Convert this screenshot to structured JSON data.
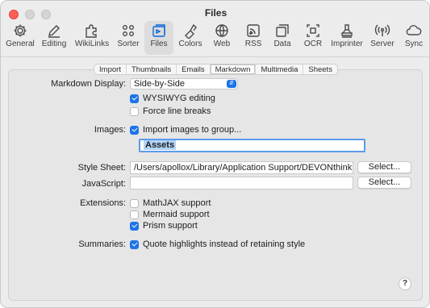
{
  "window": {
    "title": "Files"
  },
  "toolbar": {
    "items": [
      {
        "label": "General",
        "icon": "gear-icon"
      },
      {
        "label": "Editing",
        "icon": "pencil-icon"
      },
      {
        "label": "WikiLinks",
        "icon": "puzzle-icon"
      },
      {
        "label": "Sorter",
        "icon": "grid-dots-icon"
      },
      {
        "label": "Files",
        "icon": "files-icon",
        "active": true
      },
      {
        "label": "Colors",
        "icon": "paint-icon"
      },
      {
        "label": "Web",
        "icon": "globe-icon"
      },
      {
        "label": "RSS",
        "icon": "rss-icon"
      },
      {
        "label": "Data",
        "icon": "data-icon"
      },
      {
        "label": "OCR",
        "icon": "ocr-icon"
      },
      {
        "label": "Imprinter",
        "icon": "stamp-icon"
      },
      {
        "label": "Server",
        "icon": "broadcast-icon"
      },
      {
        "label": "Sync",
        "icon": "cloud-icon"
      }
    ]
  },
  "tabs": [
    "Import",
    "Thumbnails",
    "Emails",
    "Markdown",
    "Multimedia",
    "Sheets"
  ],
  "selected_tab": "Markdown",
  "markdown_display": {
    "label": "Markdown Display:",
    "value": "Side-by-Side"
  },
  "options": {
    "wysiwyg": {
      "label": "WYSIWYG editing",
      "checked": true
    },
    "force_breaks": {
      "label": "Force line breaks",
      "checked": false
    }
  },
  "images": {
    "label": "Images:",
    "import_label": "Import images to group...",
    "import_checked": true,
    "group_value": "Assets"
  },
  "style_sheet": {
    "label": "Style Sheet:",
    "value": "/Users/apollox/Library/Application Support/DEVONthink 3/StyleShe",
    "button": "Select..."
  },
  "javascript": {
    "label": "JavaScript:",
    "value": "",
    "button": "Select..."
  },
  "extensions": {
    "label": "Extensions:",
    "items": [
      {
        "label": "MathJAX support",
        "checked": false
      },
      {
        "label": "Mermaid support",
        "checked": false
      },
      {
        "label": "Prism support",
        "checked": true
      }
    ]
  },
  "summaries": {
    "label": "Summaries:",
    "option_label": "Quote highlights instead of retaining style",
    "checked": true
  },
  "help": {
    "label": "?"
  },
  "colors": {
    "accent": "#1d73e8",
    "close": "#ff5f57"
  }
}
